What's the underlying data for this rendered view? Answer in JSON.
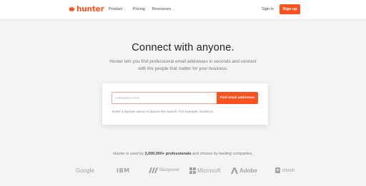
{
  "nav": {
    "logo_text": "hunter",
    "links": [
      {
        "label": "Product",
        "has_dropdown": true
      },
      {
        "label": "Pricing",
        "has_dropdown": false
      },
      {
        "label": "Resources",
        "has_dropdown": true
      }
    ],
    "signin_label": "Sign in",
    "signup_label": "Sign up"
  },
  "hero": {
    "title": "Connect with anyone.",
    "subtitle": "Hunter lets you find professional email addresses in seconds and connect with the people that matter for your business."
  },
  "search": {
    "placeholder": "company.com",
    "value": "",
    "button_label": "Find email addresses",
    "hint": "Enter a domain name to launch the search. For example, hunter.io."
  },
  "trusted": {
    "prefix": "Hunter is used by ",
    "highlight": "2,000,000+ professionals",
    "suffix": " and chosen by leading companies."
  },
  "brands": {
    "google": "Google",
    "ibm": "IBM",
    "manpower": "Manpower",
    "microsoft": "Microsoft",
    "adobe": "Adobe",
    "invision_box": "in",
    "invision_rest": "vision"
  },
  "colors": {
    "accent": "#fa5320",
    "background": "#f4f4f3",
    "brand_gray": "#a3a3a3"
  }
}
